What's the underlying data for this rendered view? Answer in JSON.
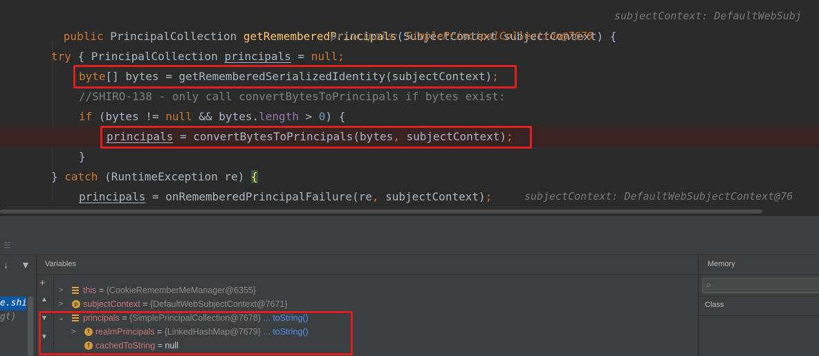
{
  "editor": {
    "line1": {
      "kw_public": "public",
      "type": "PrincipalCollection",
      "method": "getRememberedPrincipals",
      "params": "(SubjectContext subjectContext) {",
      "hint": "subjectContext: DefaultWebSubj"
    },
    "line2": {
      "type": "PrincipalCollection",
      "var": "principals",
      "assign": " = ",
      "kw_null": "null",
      "semi": ";",
      "hint_key": "principals:",
      "hint_val": "SimplePrincipalCollection@7678"
    },
    "line3": {
      "kw_try": "try",
      "rest": " {"
    },
    "line4": {
      "kw_byte": "byte",
      "rest1": "[] bytes = ",
      "method": "getRememberedSerializedIdentity",
      "rest2": "(subjectContext)",
      "semi": ";"
    },
    "line5": {
      "comment": "//SHIRO-138 - only call convertBytesToPrincipals if bytes exist:"
    },
    "line6": {
      "kw_if": "if",
      "rest1": " (bytes != ",
      "kw_null": "null",
      "rest2": " && bytes.",
      "field": "length",
      "rest3": " > ",
      "num": "0",
      "rest4": ") {"
    },
    "line7": {
      "var": "principals",
      "rest1": " = convertBytesToPrincipals(bytes",
      "comma": ",",
      "rest2": " subjectContext)",
      "semi": ";"
    },
    "line8": {
      "brace": "}"
    },
    "line9": {
      "brace": "} ",
      "kw_catch": "catch",
      "rest": " (RuntimeException re) ",
      "open": "{"
    },
    "line10": {
      "var": "principals",
      "rest1": " = onRememberedPrincipalFailure(re",
      "comma": ",",
      "rest2": " subjectContext)",
      "semi": ";",
      "hint": "subjectContext: DefaultWebSubjectContext@76"
    }
  },
  "debugger": {
    "variables_title": "Variables",
    "memory_title": "Memory",
    "memory_column": "Class",
    "frame_selected": "e.shiro.",
    "frame_sub": "gt)",
    "variables": [
      {
        "name": "this",
        "eq": " = ",
        "value": "{CookieRememberMeManager@6355}",
        "icon": "lines",
        "expandable": true
      },
      {
        "name": "subjectContext",
        "eq": " = ",
        "value": "{DefaultWebSubjectContext@7671}",
        "icon": "p",
        "expandable": true
      },
      {
        "name": "principals",
        "eq": " = ",
        "value": "{SimplePrincipalCollection@7678}",
        "link": "... toString()",
        "icon": "lines",
        "expanded": true
      },
      {
        "name": "realmPrincipals",
        "eq": " = ",
        "value": "{LinkedHashMap@7679}",
        "link": "... toString()",
        "icon": "f",
        "expandable": true
      },
      {
        "name": "cachedToString",
        "eq": " = ",
        "value": "null",
        "icon": "f",
        "expandable": false
      }
    ]
  }
}
